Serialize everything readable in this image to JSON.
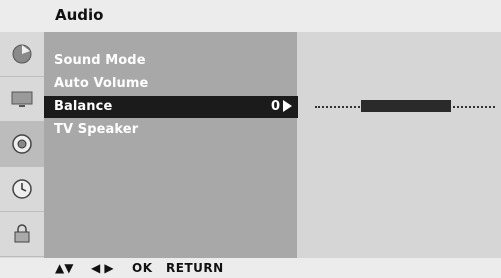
{
  "header": {
    "title": "Audio"
  },
  "menu": {
    "items": [
      {
        "label": "Sound Mode"
      },
      {
        "label": "Auto Volume"
      },
      {
        "label": "Balance",
        "value": "0",
        "selected": true
      },
      {
        "label": "TV Speaker"
      }
    ]
  },
  "balance": {
    "value": 0
  },
  "icons": [
    "picture-icon",
    "screen-icon",
    "audio-icon",
    "clock-icon",
    "lock-icon"
  ],
  "footer": {
    "updown_glyph": "▲▼",
    "leftright_glyph": "◀ ▶",
    "ok_label": "OK",
    "return_label": "RETURN"
  },
  "colors": {
    "highlight": "#1b1b1b",
    "list_bg": "#a8a8a8",
    "panel_bg": "#d6d6d6"
  }
}
